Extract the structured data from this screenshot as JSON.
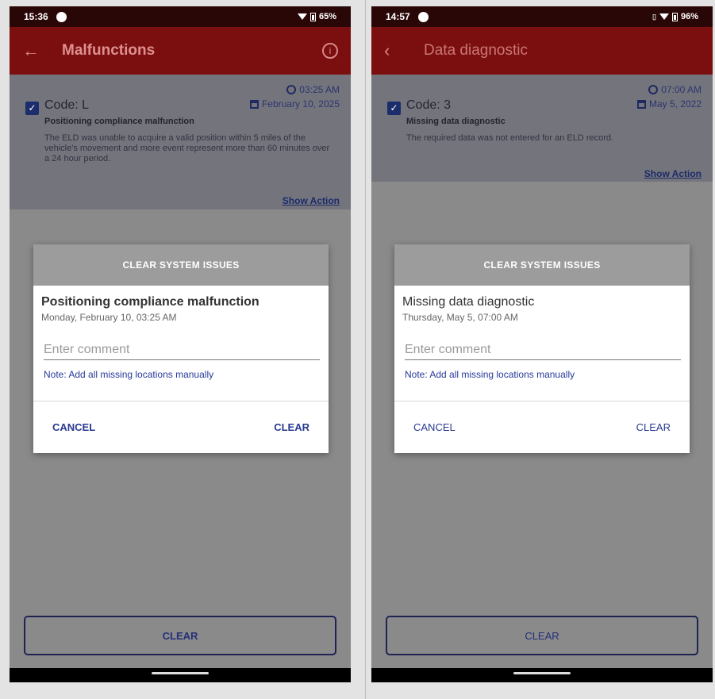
{
  "left": {
    "status": {
      "time": "15:36",
      "battery": "65%"
    },
    "app_bar": {
      "title": "Malfunctions"
    },
    "card": {
      "code": "Code: L",
      "time": "03:25 AM",
      "date": "February 10, 2025",
      "subtitle": "Positioning compliance malfunction",
      "description": "The ELD was unable to acquire a valid position within 5 miles of the vehicle's movement and more event represent more than 60 minutes over a 24 hour period.",
      "show_action": "Show Action"
    },
    "dialog": {
      "header": "CLEAR SYSTEM ISSUES",
      "title": "Positioning compliance malfunction",
      "date": "Monday, February 10, 03:25 AM",
      "placeholder": "Enter comment",
      "note": "Note: Add all missing locations manually",
      "cancel": "CANCEL",
      "clear": "CLEAR"
    },
    "bottom_button": "CLEAR"
  },
  "right": {
    "status": {
      "time": "14:57",
      "battery": "96%"
    },
    "app_bar": {
      "title": "Data diagnostic"
    },
    "card": {
      "code": "Code: 3",
      "time": "07:00 AM",
      "date": "May 5, 2022",
      "subtitle": "Missing data diagnostic",
      "description": "The required data was not entered for an ELD record.",
      "show_action": "Show Action"
    },
    "dialog": {
      "header": "CLEAR SYSTEM ISSUES",
      "title": "Missing data diagnostic",
      "date": "Thursday, May 5, 07:00 AM",
      "placeholder": "Enter comment",
      "note": "Note: Add all missing locations manually",
      "cancel": "CANCEL",
      "clear": "CLEAR"
    },
    "bottom_button": "CLEAR"
  }
}
